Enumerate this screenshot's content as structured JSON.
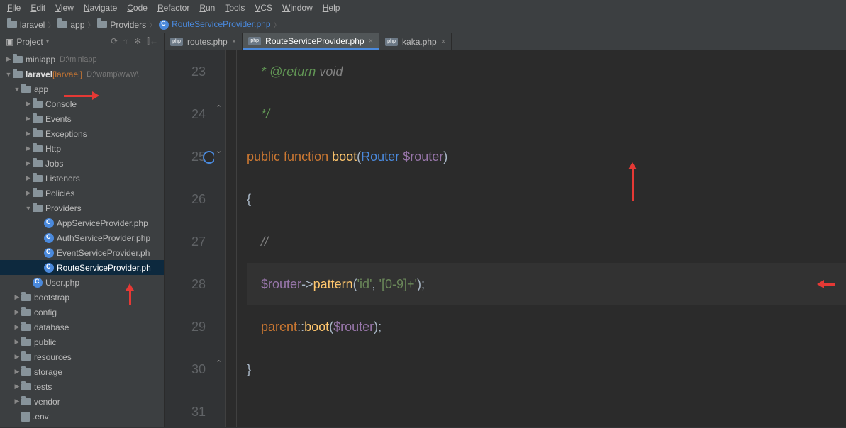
{
  "menu": [
    "File",
    "Edit",
    "View",
    "Navigate",
    "Code",
    "Refactor",
    "Run",
    "Tools",
    "VCS",
    "Window",
    "Help"
  ],
  "breadcrumb": {
    "items": [
      {
        "type": "folder",
        "label": "laravel"
      },
      {
        "type": "folder",
        "label": "app"
      },
      {
        "type": "folder",
        "label": "Providers"
      },
      {
        "type": "php",
        "label": "RouteServiceProvider.php"
      }
    ]
  },
  "sidebar": {
    "title": "Project",
    "tree": [
      {
        "depth": 0,
        "arrow": "▶",
        "icon": "folder",
        "label": "miniapp",
        "hint": "D:\\miniapp"
      },
      {
        "depth": 0,
        "arrow": "▼",
        "icon": "folder",
        "label": "laravel",
        "bold": true,
        "bracket": "[larvael]",
        "hint": "D:\\wamp\\www\\"
      },
      {
        "depth": 1,
        "arrow": "▼",
        "icon": "folder",
        "label": "app"
      },
      {
        "depth": 2,
        "arrow": "▶",
        "icon": "folder",
        "label": "Console"
      },
      {
        "depth": 2,
        "arrow": "▶",
        "icon": "folder",
        "label": "Events"
      },
      {
        "depth": 2,
        "arrow": "▶",
        "icon": "folder",
        "label": "Exceptions"
      },
      {
        "depth": 2,
        "arrow": "▶",
        "icon": "folder",
        "label": "Http"
      },
      {
        "depth": 2,
        "arrow": "▶",
        "icon": "folder",
        "label": "Jobs"
      },
      {
        "depth": 2,
        "arrow": "▶",
        "icon": "folder",
        "label": "Listeners"
      },
      {
        "depth": 2,
        "arrow": "▶",
        "icon": "folder",
        "label": "Policies"
      },
      {
        "depth": 2,
        "arrow": "▼",
        "icon": "folder",
        "label": "Providers"
      },
      {
        "depth": 3,
        "arrow": "",
        "icon": "php",
        "label": "AppServiceProvider.php"
      },
      {
        "depth": 3,
        "arrow": "",
        "icon": "php",
        "label": "AuthServiceProvider.php"
      },
      {
        "depth": 3,
        "arrow": "",
        "icon": "php",
        "label": "EventServiceProvider.ph"
      },
      {
        "depth": 3,
        "arrow": "",
        "icon": "php",
        "label": "RouteServiceProvider.ph",
        "selected": true
      },
      {
        "depth": 2,
        "arrow": "",
        "icon": "php",
        "label": "User.php"
      },
      {
        "depth": 1,
        "arrow": "▶",
        "icon": "folder",
        "label": "bootstrap"
      },
      {
        "depth": 1,
        "arrow": "▶",
        "icon": "folder",
        "label": "config"
      },
      {
        "depth": 1,
        "arrow": "▶",
        "icon": "folder",
        "label": "database"
      },
      {
        "depth": 1,
        "arrow": "▶",
        "icon": "folder",
        "label": "public"
      },
      {
        "depth": 1,
        "arrow": "▶",
        "icon": "folder",
        "label": "resources"
      },
      {
        "depth": 1,
        "arrow": "▶",
        "icon": "folder",
        "label": "storage"
      },
      {
        "depth": 1,
        "arrow": "▶",
        "icon": "folder",
        "label": "tests"
      },
      {
        "depth": 1,
        "arrow": "▶",
        "icon": "folder",
        "label": "vendor"
      },
      {
        "depth": 1,
        "arrow": "",
        "icon": "file",
        "label": ".env"
      }
    ]
  },
  "tabs": [
    {
      "label": "routes.php",
      "active": false
    },
    {
      "label": "RouteServiceProvider.php",
      "active": true
    },
    {
      "label": "kaka.php",
      "active": false
    }
  ],
  "editor": {
    "lines": [
      {
        "n": 23,
        "html": "    <span class='doc'>* @return</span> <span class='com'>void</span>"
      },
      {
        "n": 24,
        "html": "    <span class='doc'>*/</span>"
      },
      {
        "n": 25,
        "html": "<span class='kw'>public</span> <span class='kw'>function</span> <span class='fn'>boot</span><span class='punct'>(</span><span class='type'>Router</span> <span class='var'>$router</span><span class='punct'>)</span>",
        "override": true
      },
      {
        "n": 26,
        "html": "<span class='punct'>{</span>"
      },
      {
        "n": 27,
        "html": "    <span class='com'>//</span>"
      },
      {
        "n": 28,
        "html": "    <span class='var'>$router</span><span class='punct'>-></span><span class='fn'>pattern</span><span class='punct'>(</span><span class='str'>'id'</span><span class='punct'>,</span> <span class='str'>'[0-9]+'</span><span class='punct'>);</span>",
        "hl": true
      },
      {
        "n": 29,
        "html": "    <span class='kw'>parent</span><span class='punct'>::</span><span class='fn'>boot</span><span class='punct'>(</span><span class='var'>$router</span><span class='punct'>);</span>"
      },
      {
        "n": 30,
        "html": "<span class='punct'>}</span>"
      },
      {
        "n": 31,
        "html": ""
      }
    ]
  }
}
